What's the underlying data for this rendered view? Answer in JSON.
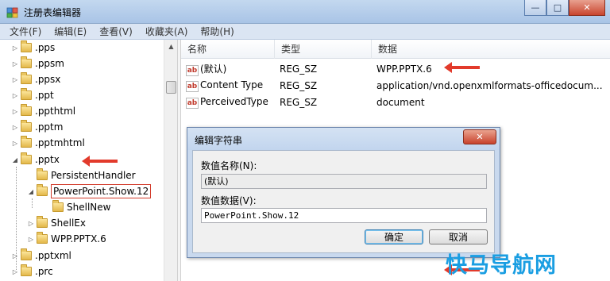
{
  "window": {
    "title": "注册表编辑器",
    "controls": {
      "minimize": "—",
      "maximize": "□",
      "close": "✕"
    }
  },
  "menu": [
    "文件(F)",
    "编辑(E)",
    "查看(V)",
    "收藏夹(A)",
    "帮助(H)"
  ],
  "tree": {
    "items": [
      {
        "label": ".pps",
        "expander": "▷",
        "level": 1
      },
      {
        "label": ".ppsm",
        "expander": "▷",
        "level": 1
      },
      {
        "label": ".ppsx",
        "expander": "▷",
        "level": 1
      },
      {
        "label": ".ppt",
        "expander": "▷",
        "level": 1
      },
      {
        "label": ".ppthtml",
        "expander": "▷",
        "level": 1
      },
      {
        "label": ".pptm",
        "expander": "▷",
        "level": 1
      },
      {
        "label": ".pptmhtml",
        "expander": "▷",
        "level": 1
      },
      {
        "label": ".pptx",
        "expander": "◢",
        "level": 1
      },
      {
        "label": "PersistentHandler",
        "expander": "",
        "level": 2
      },
      {
        "label": "PowerPoint.Show.12",
        "expander": "◢",
        "level": 2
      },
      {
        "label": "ShellNew",
        "expander": "",
        "level": 3
      },
      {
        "label": "ShellEx",
        "expander": "▷",
        "level": 2
      },
      {
        "label": "WPP.PPTX.6",
        "expander": "▷",
        "level": 2
      },
      {
        "label": ".pptxml",
        "expander": "▷",
        "level": 1
      },
      {
        "label": ".prc",
        "expander": "▷",
        "level": 1
      }
    ]
  },
  "list": {
    "columns": [
      "名称",
      "类型",
      "数据"
    ],
    "rows": [
      {
        "icon": "ab",
        "name": "(默认)",
        "type": "REG_SZ",
        "data": "WPP.PPTX.6"
      },
      {
        "icon": "ab",
        "name": "Content Type",
        "type": "REG_SZ",
        "data": "application/vnd.openxmlformats-officedocum..."
      },
      {
        "icon": "ab",
        "name": "PerceivedType",
        "type": "REG_SZ",
        "data": "document"
      }
    ]
  },
  "dialog": {
    "title": "编辑字符串",
    "close": "✕",
    "name_label": "数值名称(N):",
    "name_value": "(默认)",
    "data_label": "数值数据(V):",
    "data_value": "PowerPoint.Show.12",
    "ok": "确定",
    "cancel": "取消"
  },
  "watermark": "快马导航网",
  "colors": {
    "annotation_red": "#e23a2b",
    "watermark_blue": "#1a9ee2"
  }
}
